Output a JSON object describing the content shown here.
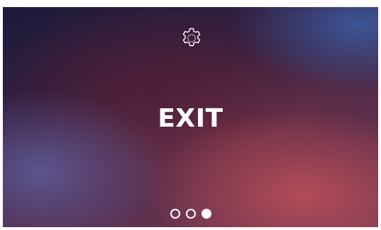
{
  "screen": {
    "title": "EXIT",
    "settings_icon": "gear-icon",
    "pagination": {
      "total": 3,
      "active_index": 2
    }
  }
}
